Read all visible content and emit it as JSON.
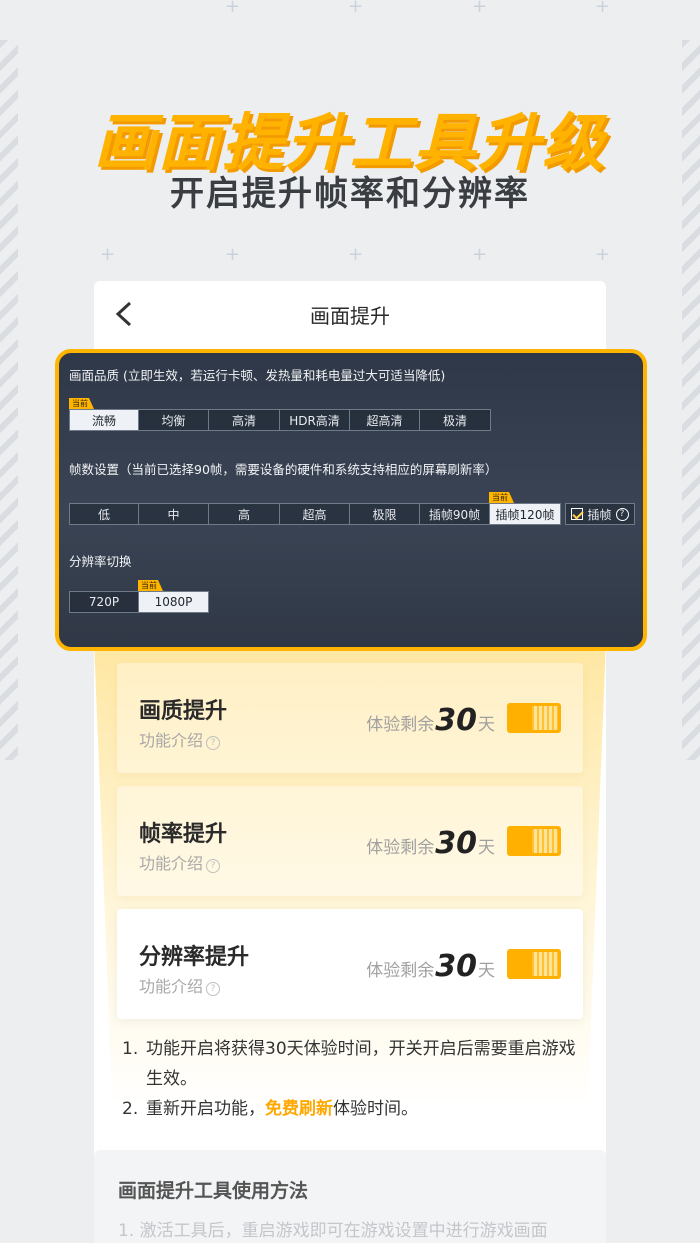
{
  "headline": "画面提升工具升级",
  "subhead": "开启提升帧率和分辨率",
  "card": {
    "title": "画面提升",
    "back_icon": "chevron-left-icon"
  },
  "panel": {
    "quality": {
      "label": "画面品质 (立即生效，若运行卡顿、发热量和耗电量过大可适当降低)",
      "current_tag": "当前",
      "options": [
        "流畅",
        "均衡",
        "高清",
        "HDR高清",
        "超高清",
        "极清"
      ],
      "selected": "流畅"
    },
    "fps": {
      "label": "帧数设置（当前已选择90帧，需要设备的硬件和系统支持相应的屏幕刷新率）",
      "current_tag": "当前",
      "options": [
        "低",
        "中",
        "高",
        "超高",
        "极限",
        "插帧90帧",
        "插帧120帧"
      ],
      "selected": "插帧120帧",
      "interp_checkbox_label": "插帧",
      "interp_checked": true,
      "help": "?"
    },
    "resolution": {
      "label": "分辨率切换",
      "current_tag": "当前",
      "options": [
        "720P",
        "1080P"
      ],
      "selected": "1080P"
    }
  },
  "features": [
    {
      "title": "画质提升",
      "sub": "功能介绍",
      "trial_prefix": "体验剩余",
      "days": "30",
      "trial_suffix": "天",
      "enabled": true
    },
    {
      "title": "帧率提升",
      "sub": "功能介绍",
      "trial_prefix": "体验剩余",
      "days": "30",
      "trial_suffix": "天",
      "enabled": true
    },
    {
      "title": "分辨率提升",
      "sub": "功能介绍",
      "trial_prefix": "体验剩余",
      "days": "30",
      "trial_suffix": "天",
      "enabled": true
    }
  ],
  "notes": {
    "n1_idx": "1.",
    "n1": "功能开启将获得30天体验时间，开关开启后需要重启游戏生效。",
    "n2_idx": "2.",
    "n2_pre": "重新开启功能，",
    "n2_hl": "免费刷新",
    "n2_post": "体验时间。"
  },
  "usage": {
    "title": "画面提升工具使用方法",
    "text": "1. 激活工具后，重启游戏即可在游戏设置中进行游戏画面"
  },
  "colors": {
    "accent": "#ffb400",
    "panel_bg": "#2e3848",
    "toggle_on": "#ffb000"
  }
}
